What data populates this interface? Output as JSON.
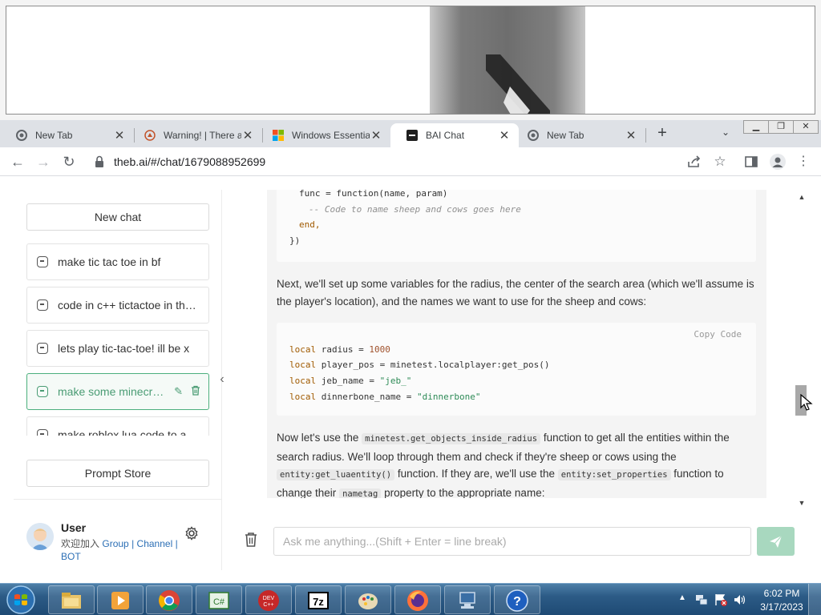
{
  "tabs": [
    {
      "title": "New Tab"
    },
    {
      "title": "Warning! | There a"
    },
    {
      "title": "Windows Essentia"
    },
    {
      "title": "BAI Chat"
    },
    {
      "title": "New Tab"
    }
  ],
  "toolbar": {
    "url": "theb.ai/#/chat/1679088952699"
  },
  "sidebar": {
    "new_chat": "New chat",
    "chats": [
      {
        "label": "make tic tac toe in bf"
      },
      {
        "label": "code in c++ tictactoe in the console"
      },
      {
        "label": "lets play tic-tac-toe! ill be x"
      },
      {
        "label": "make some minecraft code"
      },
      {
        "label": "make roblox lua code to a"
      }
    ],
    "prompt_store": "Prompt Store",
    "user": {
      "name": "User",
      "desc_prefix": "欢迎加入",
      "link_group": "Group",
      "sep": "|",
      "link_channel": "Channel",
      "link_bot": "BOT"
    }
  },
  "messages": {
    "code1": {
      "line1": "func = function(name, param)",
      "line2": "-- Code to name sheep and cows goes here",
      "line3": "end,",
      "line4": "})"
    },
    "para1": "Next, we'll set up some variables for the radius, the center of the search area (which we'll assume is the player's location), and the names we want to use for the sheep and cows:",
    "code2": {
      "copy": "Copy Code",
      "kw_local": "local",
      "v1_name": " radius = ",
      "v1_val": "1000",
      "v2_name": " player_pos = minetest.localplayer:get_pos()",
      "v3_name": " jeb_name = ",
      "v3_val": "\"jeb_\"",
      "v4_name": " dinnerbone_name = ",
      "v4_val": "\"dinnerbone\""
    },
    "para2": {
      "a": "Now let's use the ",
      "c1": "minetest.get_objects_inside_radius",
      "b": " function to get all the entities within the search radius. We'll loop through them and check if they're sheep or cows using the ",
      "c2": "entity:get_luaentity()",
      "c": " function. If they are, we'll use the ",
      "c3": "entity:set_properties",
      "d": " function to change their ",
      "c4": "nametag",
      "e": " property to the appropriate name:"
    }
  },
  "input": {
    "placeholder": "Ask me anything...(Shift + Enter = line break)"
  },
  "taskbar": {
    "time": "6:02 PM",
    "date": "3/17/2023"
  }
}
